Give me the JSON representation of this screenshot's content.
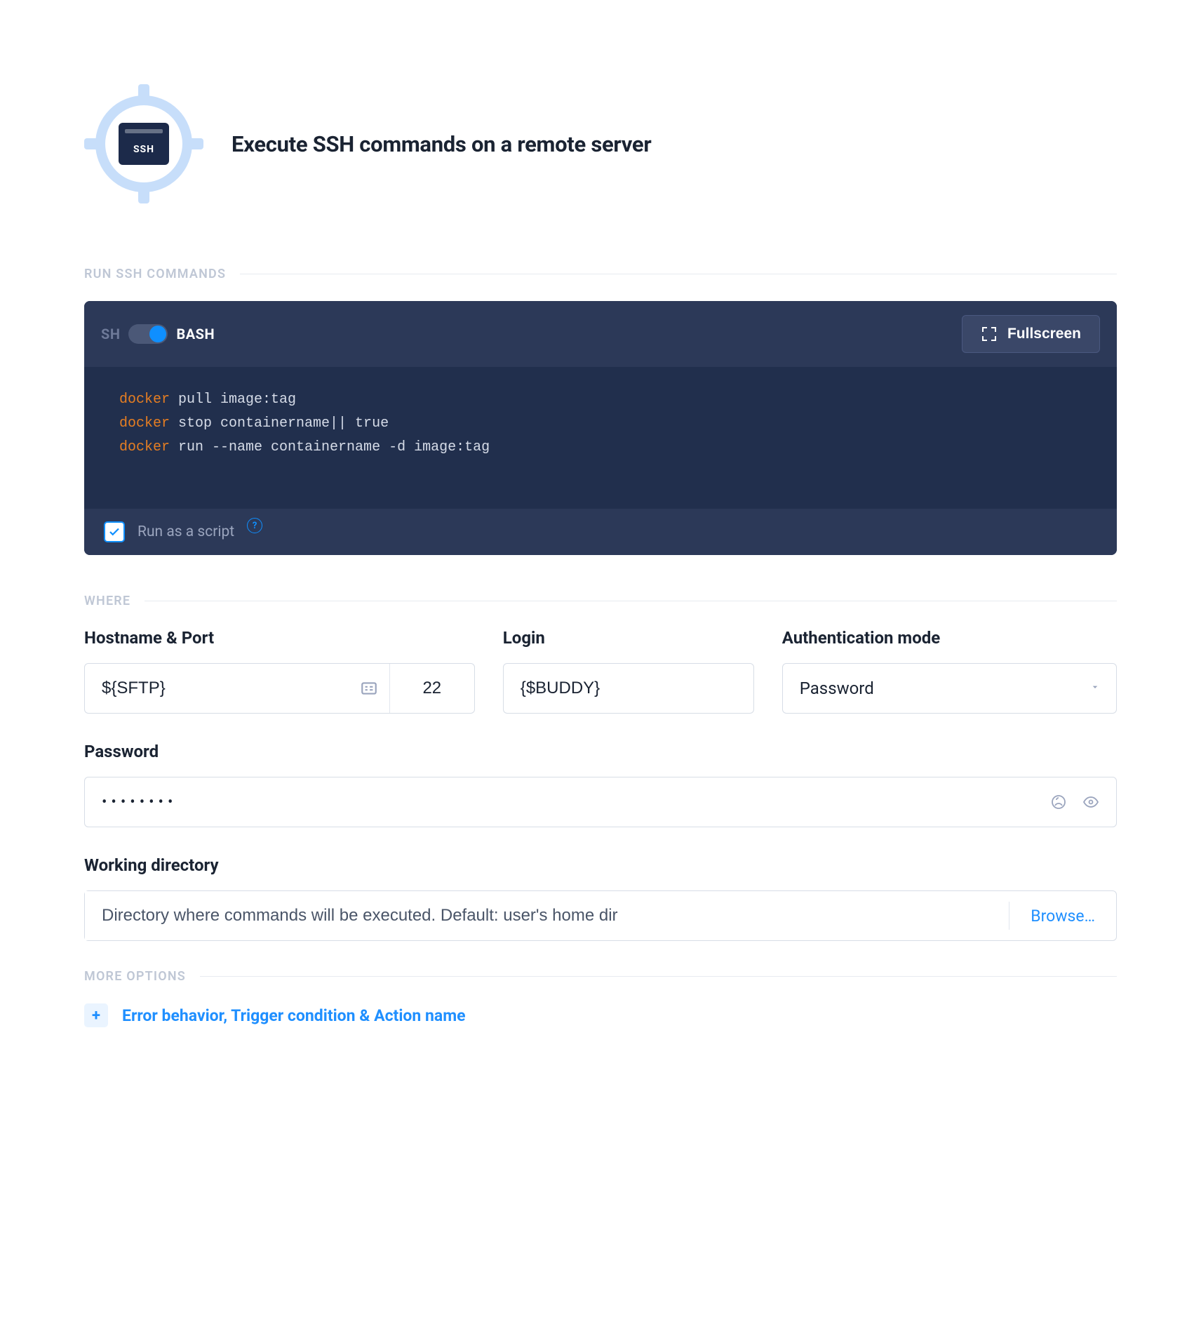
{
  "header": {
    "badge_label": "SSH",
    "title": "Execute SSH commands on a remote server"
  },
  "sections": {
    "run": "RUN SSH COMMANDS",
    "where": "WHERE",
    "more": "MORE OPTIONS"
  },
  "code_panel": {
    "shell_left": "SH",
    "shell_right": "BASH",
    "shell_active": "BASH",
    "fullscreen_label": "Fullscreen",
    "lines": [
      {
        "keyword": "docker",
        "rest": " pull image:tag"
      },
      {
        "keyword": "docker",
        "rest": " stop containername|| true"
      },
      {
        "keyword": "docker",
        "rest": " run --name containername -d image:tag"
      }
    ],
    "run_as_script_label": "Run as a script",
    "run_as_script_checked": true
  },
  "where": {
    "hostname_port_label": "Hostname & Port",
    "hostname_value": "${SFTP}",
    "port_value": "22",
    "login_label": "Login",
    "login_value": "{$BUDDY}",
    "auth_label": "Authentication mode",
    "auth_value": "Password",
    "password_label": "Password",
    "password_masked": "••••••••",
    "working_dir_label": "Working directory",
    "working_dir_placeholder": "Directory where commands will be executed. Default: user's home dir",
    "browse_label": "Browse…"
  },
  "more_options": {
    "link_label": "Error behavior, Trigger condition & Action name"
  }
}
